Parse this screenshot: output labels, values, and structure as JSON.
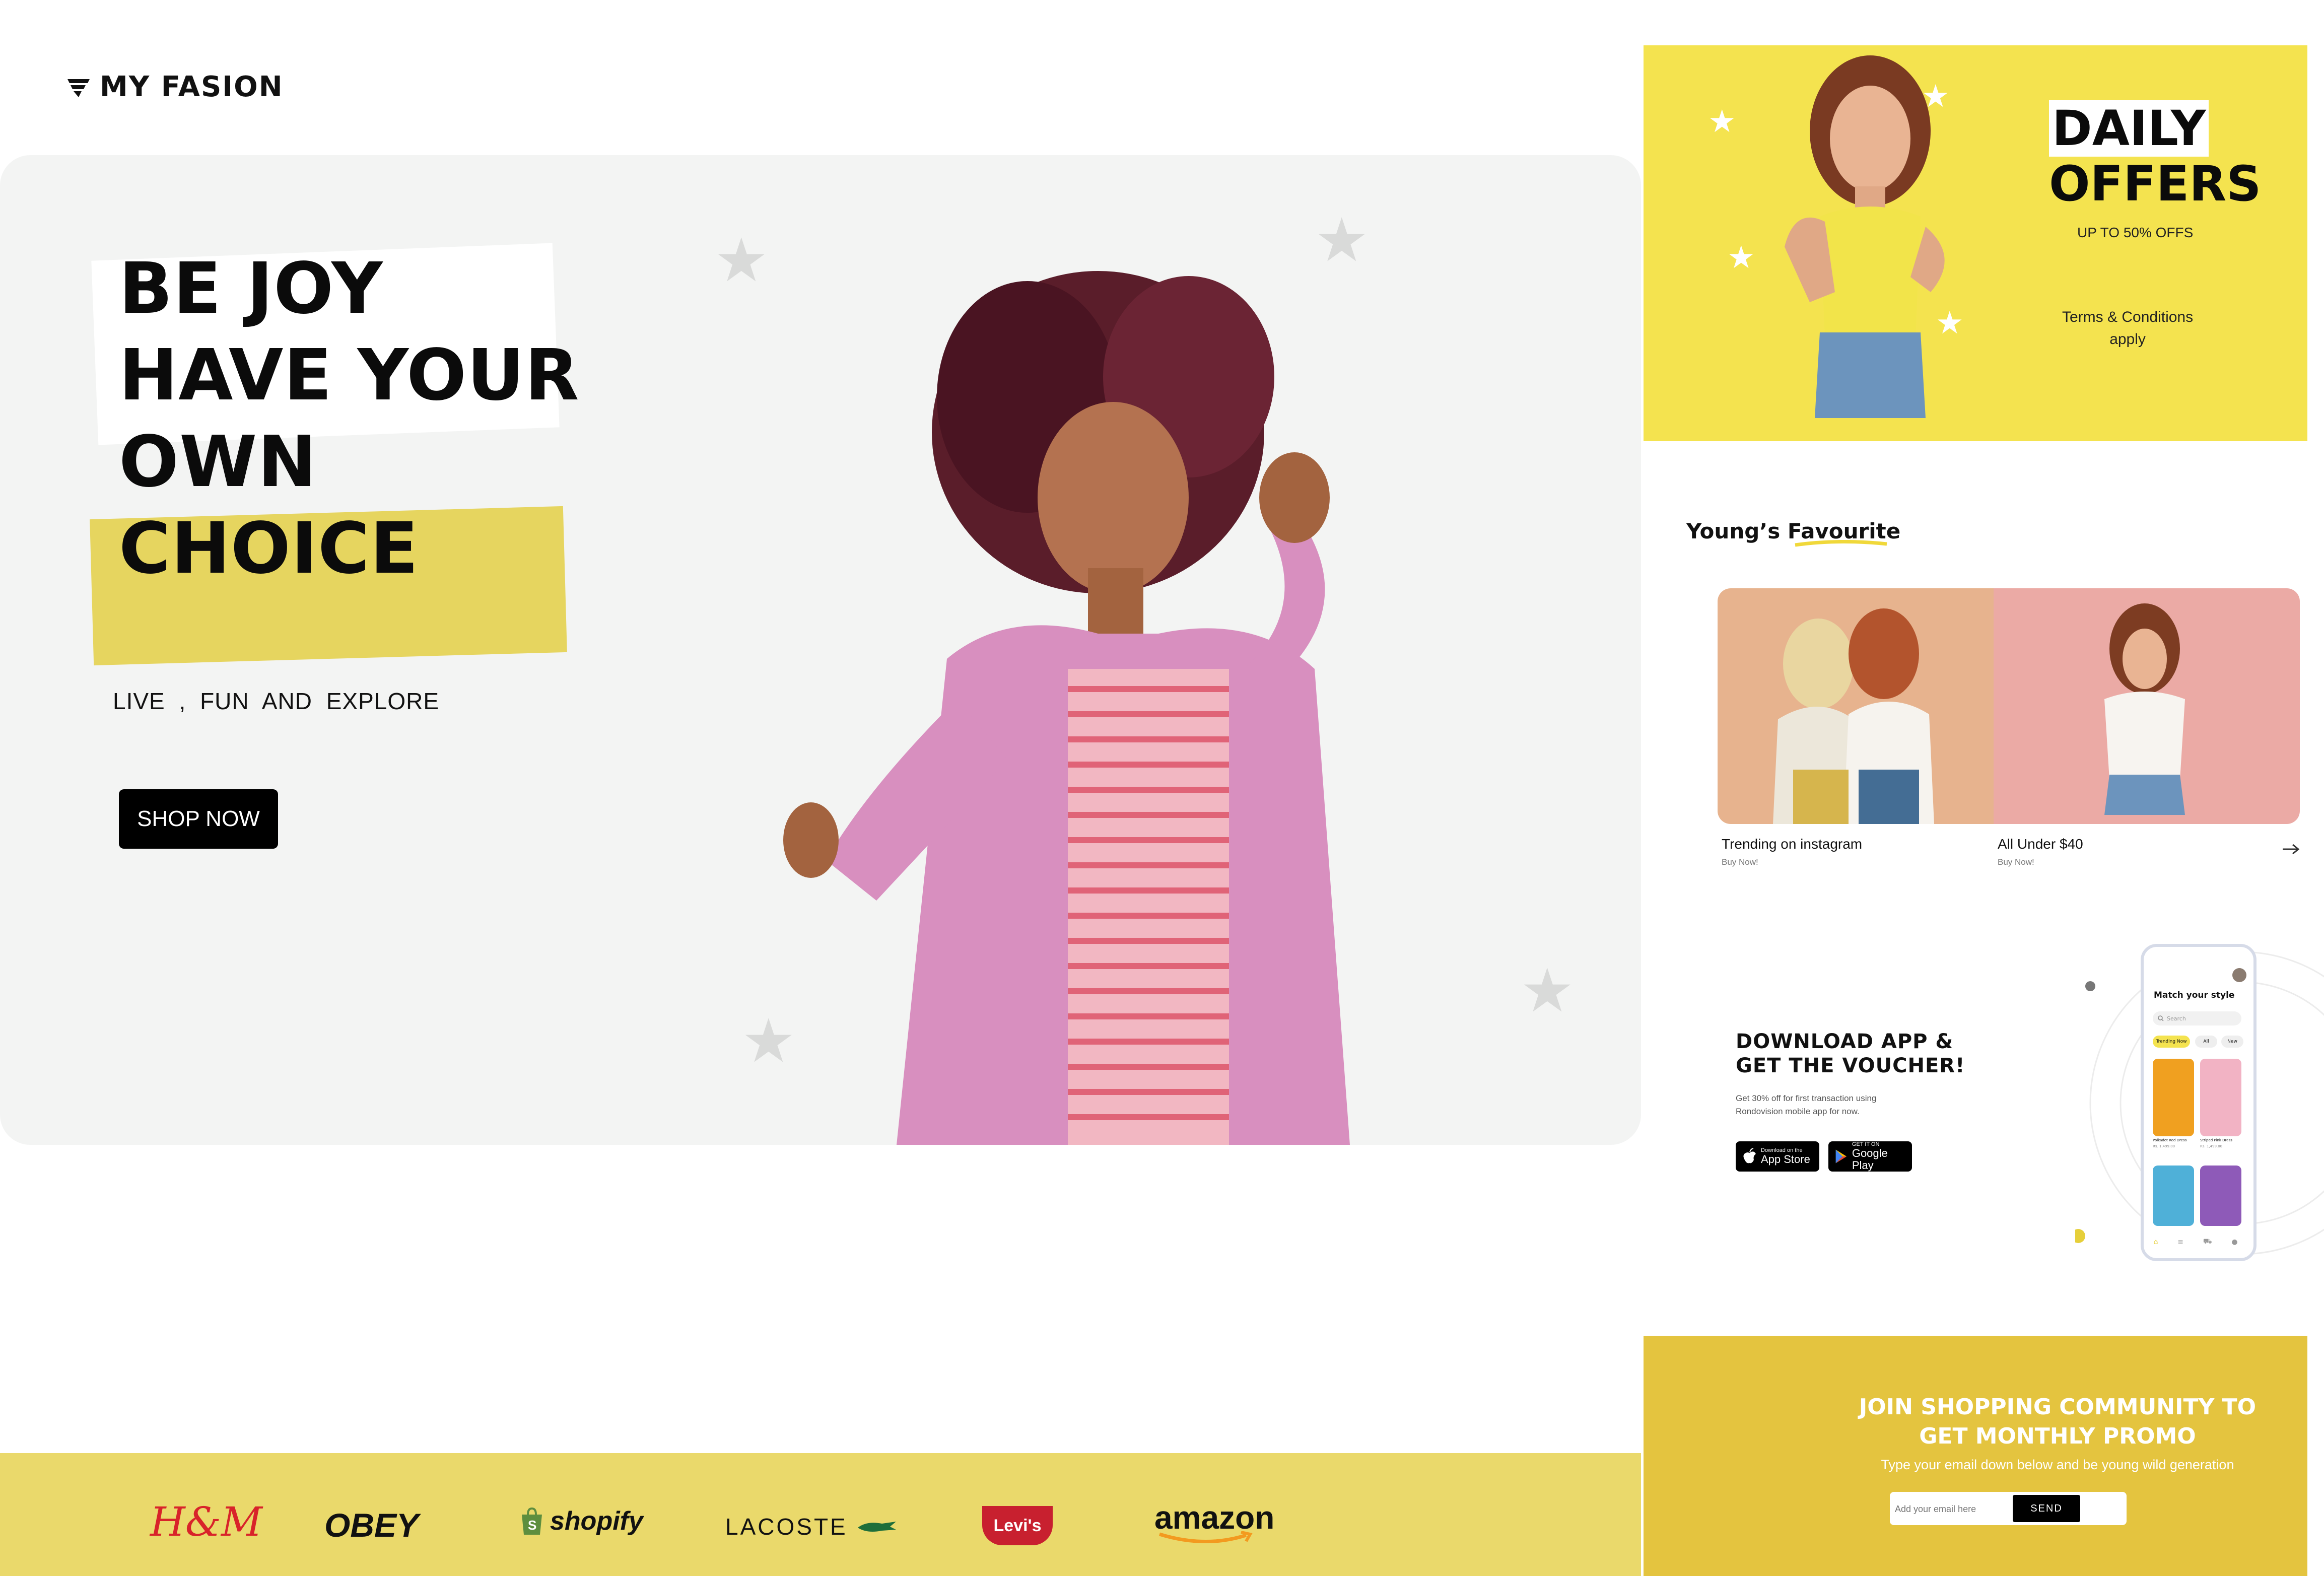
{
  "brand": {
    "name": "MY FASION"
  },
  "hero": {
    "title_lines": [
      "BE JOY",
      "HAVE YOUR",
      "OWN",
      "CHOICE"
    ],
    "tagline": "LIVE , FUN  AND  EXPLORE",
    "cta": "SHOP NOW"
  },
  "brands": [
    "H&M",
    "OBEY",
    "shopify",
    "LACOSTE",
    "Levi's",
    "amazon"
  ],
  "offers": {
    "title_1": "DAILY",
    "title_2": "OFFERS",
    "subtitle": "UP TO 50% OFFS",
    "terms_1": "Terms & Conditions",
    "terms_2": "apply"
  },
  "favourites": {
    "title": "Young’s Favourite",
    "cards": [
      {
        "label": "Trending on instagram",
        "sub": "Buy Now!"
      },
      {
        "label": "All Under $40",
        "sub": "Buy Now!"
      }
    ]
  },
  "download": {
    "title_1": "DOWNLOAD APP &",
    "title_2": "GET THE VOUCHER!",
    "desc_1": "Get 30% off for first transaction using",
    "desc_2": "Rondovision mobile app for now.",
    "appstore_small": "Download on the",
    "appstore_big": "App Store",
    "gplay_small": "GET IT ON",
    "gplay_big": "Google Play"
  },
  "phone": {
    "heading": "Match your style",
    "search_placeholder": "Search",
    "chips": [
      "Trending Now",
      "All",
      "New"
    ],
    "items": [
      {
        "name": "Polkadot Red Dress",
        "price": "Rs. 1,499.00"
      },
      {
        "name": "Striped Pink Dress",
        "price": "Rs. 1,499.00"
      }
    ]
  },
  "join": {
    "title_1": "JOIN SHOPPING COMMUNITY TO",
    "title_2": "GET MONTHLY PROMO",
    "desc": "Type your email down below and be young wild generation",
    "placeholder": "Add your email here",
    "button": "SEND"
  },
  "colors": {
    "yellow": "#ead96b",
    "offer_yellow": "#f4e34f",
    "join_yellow": "#e4c43f",
    "dark": "#0b0b0b"
  }
}
